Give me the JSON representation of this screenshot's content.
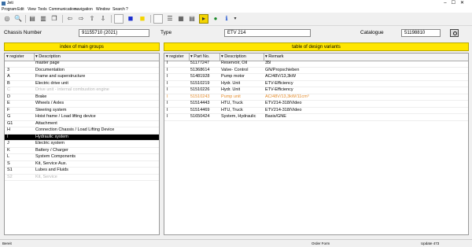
{
  "window": {
    "title": "Jeti"
  },
  "menu": [
    "Program",
    "Edit",
    "View",
    "Tools",
    "Communication",
    "navigation",
    "Window",
    "Search",
    "?"
  ],
  "header": {
    "chassis_label": "Chassis Number",
    "chassis_value": "91155710 (2021)",
    "type_label": "Type",
    "type_value": "ETV 214",
    "catalogue_label": "Catalogue",
    "catalogue_value": "51198810"
  },
  "left_panel": {
    "title": "index of main groups",
    "columns": [
      "register",
      "Description"
    ],
    "rows": [
      {
        "register": "",
        "description": "master page",
        "state": "normal"
      },
      {
        "register": "3",
        "description": "Documentation",
        "state": "normal"
      },
      {
        "register": "A",
        "description": "Frame and superstructure",
        "state": "normal"
      },
      {
        "register": "B",
        "description": "Electric drive unit",
        "state": "normal"
      },
      {
        "register": "C",
        "description": "Drive unit - internal combustion engine",
        "state": "dim"
      },
      {
        "register": "D",
        "description": "Brake",
        "state": "normal"
      },
      {
        "register": "E",
        "description": "Wheels / Axles",
        "state": "normal"
      },
      {
        "register": "F",
        "description": "Steering system",
        "state": "normal"
      },
      {
        "register": "G",
        "description": "Hoist frame / Load lifting device",
        "state": "normal"
      },
      {
        "register": "G1",
        "description": "Attachment",
        "state": "normal"
      },
      {
        "register": "H",
        "description": "Connection Chassis / Load Lifting Device",
        "state": "normal"
      },
      {
        "register": "I",
        "description": "Hydraulic system",
        "state": "selected"
      },
      {
        "register": "J",
        "description": "Electric system",
        "state": "normal"
      },
      {
        "register": "K",
        "description": "Battery / Charger",
        "state": "normal"
      },
      {
        "register": "L",
        "description": "System Components",
        "state": "normal"
      },
      {
        "register": "S",
        "description": "Kit, Service Aux.",
        "state": "normal"
      },
      {
        "register": "S1",
        "description": "Lubes and Fluids",
        "state": "normal"
      },
      {
        "register": "S2",
        "description": "Kit, Service",
        "state": "dim"
      }
    ]
  },
  "right_panel": {
    "title": "table of design variants",
    "columns": [
      "register",
      "Part No.",
      "Description",
      "Remark"
    ],
    "rows": [
      {
        "register": "I",
        "part": "51177247",
        "description": "Reservoir, Oil",
        "remark": "35l",
        "state": "normal"
      },
      {
        "register": "I",
        "part": "51368614",
        "description": "Valve- Control",
        "remark": "GN/Propschieben",
        "state": "normal"
      },
      {
        "register": "I",
        "part": "51481928",
        "description": "Pump motor",
        "remark": "AC/48V/13,3kW",
        "state": "normal"
      },
      {
        "register": "I",
        "part": "51510219",
        "description": "Hydr. Unit",
        "remark": "ETV-Efficiency",
        "state": "normal"
      },
      {
        "register": "I",
        "part": "51510226",
        "description": "Hydr. Unit",
        "remark": "ETV-Efficiency",
        "state": "normal"
      },
      {
        "register": "I",
        "part": "51510243",
        "description": "Pump unit",
        "remark": "AC/48V/13,3kW/11cm³",
        "state": "orange"
      },
      {
        "register": "I",
        "part": "51514443",
        "description": "HTU, Truck",
        "remark": "ETV214-318/Video",
        "state": "normal"
      },
      {
        "register": "I",
        "part": "51514469",
        "description": "HTU, Truck",
        "remark": "ETV214-318/Video",
        "state": "normal"
      },
      {
        "register": "I",
        "part": "51650424",
        "description": "System, Hydraulic",
        "remark": "Basis/GNE",
        "state": "normal"
      }
    ]
  },
  "status": {
    "left": "Bereit",
    "mid": "Order Form",
    "update": "Update 473"
  },
  "colors": {
    "panel_title": "#ffe600",
    "selected_row": "#000000",
    "orange_text": "#e28a2a",
    "dim_text": "#b4b4b4"
  }
}
